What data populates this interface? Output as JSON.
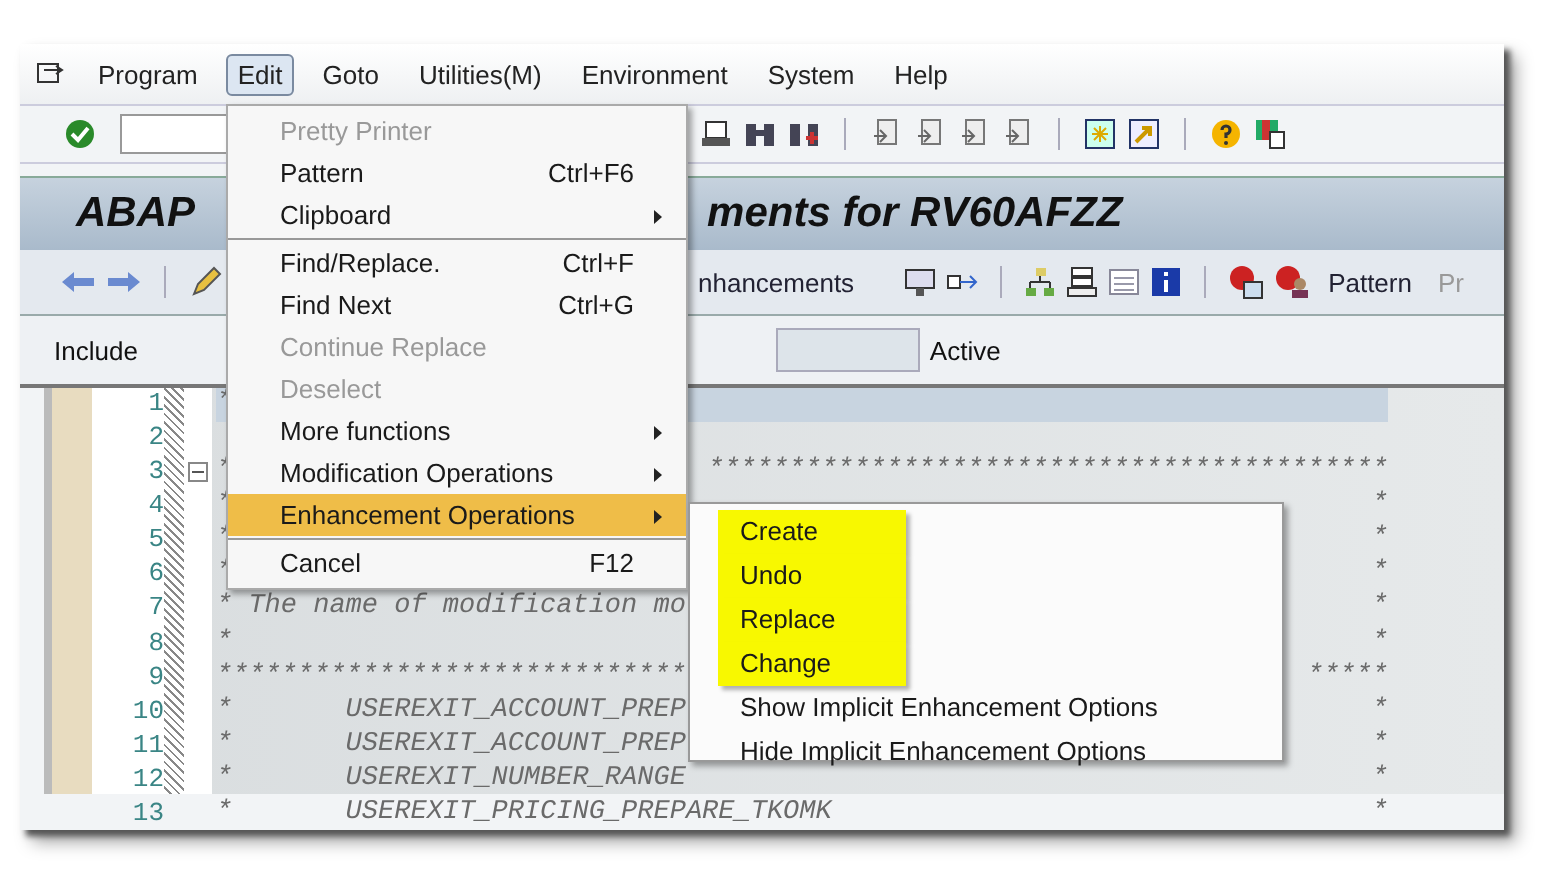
{
  "menu_bar": {
    "items": [
      {
        "label": "Program",
        "selected": false
      },
      {
        "label": "Edit",
        "selected": true
      },
      {
        "label": "Goto",
        "selected": false
      },
      {
        "label": "Utilities(M)",
        "selected": false
      },
      {
        "label": "Environment",
        "selected": false
      },
      {
        "label": "System",
        "selected": false
      },
      {
        "label": "Help",
        "selected": false
      }
    ]
  },
  "title_parts": [
    "ABAP",
    "ments for RV60AFZZ"
  ],
  "app_toolbar": {
    "buttons": [
      {
        "label": "nhancements",
        "disabled": false
      },
      {
        "label": "Pattern",
        "disabled": false
      },
      {
        "label": "Pr",
        "disabled": true
      }
    ]
  },
  "include_row": {
    "label": "Include",
    "status": "Active"
  },
  "editor": {
    "lines": [
      {
        "number": "1",
        "left": "*",
        "current": true
      },
      {
        "number": "2",
        "current": false
      },
      {
        "number": "3",
        "left": "*",
        "right": "******************************************",
        "current": false
      },
      {
        "number": "4",
        "left": "*",
        "right": "*",
        "current": false
      },
      {
        "number": "5",
        "left": "*",
        "right": "*",
        "current": false
      },
      {
        "number": "6",
        "left": "*",
        "right": "*",
        "current": false
      },
      {
        "number": "7",
        "left": "* The name of modification mo",
        "right": "*",
        "current": false
      },
      {
        "number": "8",
        "left": "*",
        "right": "*",
        "current": false
      },
      {
        "number": "9",
        "left": "*****************************",
        "right": "*****",
        "current": false
      },
      {
        "number": "10",
        "left": "*       USEREXIT_ACCOUNT_PREP",
        "right": "*",
        "current": false
      },
      {
        "number": "11",
        "left": "*       USEREXIT_ACCOUNT_PREP",
        "right": "*",
        "current": false
      },
      {
        "number": "12",
        "left": "*       USEREXIT_NUMBER_RANGE",
        "right": "*",
        "current": false
      },
      {
        "number": "13",
        "left": "*       USEREXIT_PRICING_PREPARE_TKOMK",
        "right": "*",
        "current": false
      }
    ]
  },
  "edit_menu": {
    "groups": [
      [
        {
          "label": "Pretty Printer",
          "disabled": true,
          "submenu": false,
          "selected": false
        },
        {
          "label": "Pattern",
          "shortcut": "Ctrl+F6",
          "disabled": false,
          "submenu": false,
          "selected": false
        },
        {
          "label": "Clipboard",
          "disabled": false,
          "submenu": true,
          "selected": false
        }
      ],
      [
        {
          "label": "Find/Replace.",
          "shortcut": "Ctrl+F",
          "disabled": false,
          "submenu": false,
          "selected": false
        },
        {
          "label": "Find Next",
          "shortcut": "Ctrl+G",
          "disabled": false,
          "submenu": false,
          "selected": false
        },
        {
          "label": "Continue Replace",
          "disabled": true,
          "submenu": false,
          "selected": false
        },
        {
          "label": "Deselect",
          "disabled": true,
          "submenu": false,
          "selected": false
        },
        {
          "label": "More functions",
          "disabled": false,
          "submenu": true,
          "selected": false
        },
        {
          "label": "Modification Operations",
          "disabled": false,
          "submenu": true,
          "selected": false
        },
        {
          "label": "Enhancement Operations",
          "disabled": false,
          "submenu": true,
          "selected": true
        }
      ],
      [
        {
          "label": "Cancel",
          "shortcut": "F12",
          "disabled": false,
          "submenu": false,
          "selected": false
        }
      ]
    ]
  },
  "submenu": {
    "items": [
      {
        "label": "Create",
        "highlighted": true
      },
      {
        "label": "Undo",
        "highlighted": true
      },
      {
        "label": "Replace",
        "highlighted": true
      },
      {
        "label": "Change",
        "highlighted": true
      },
      {
        "label": "Show Implicit Enhancement Options",
        "highlighted": false
      },
      {
        "label": "Hide Implicit Enhancement Options",
        "highlighted": false
      }
    ]
  }
}
